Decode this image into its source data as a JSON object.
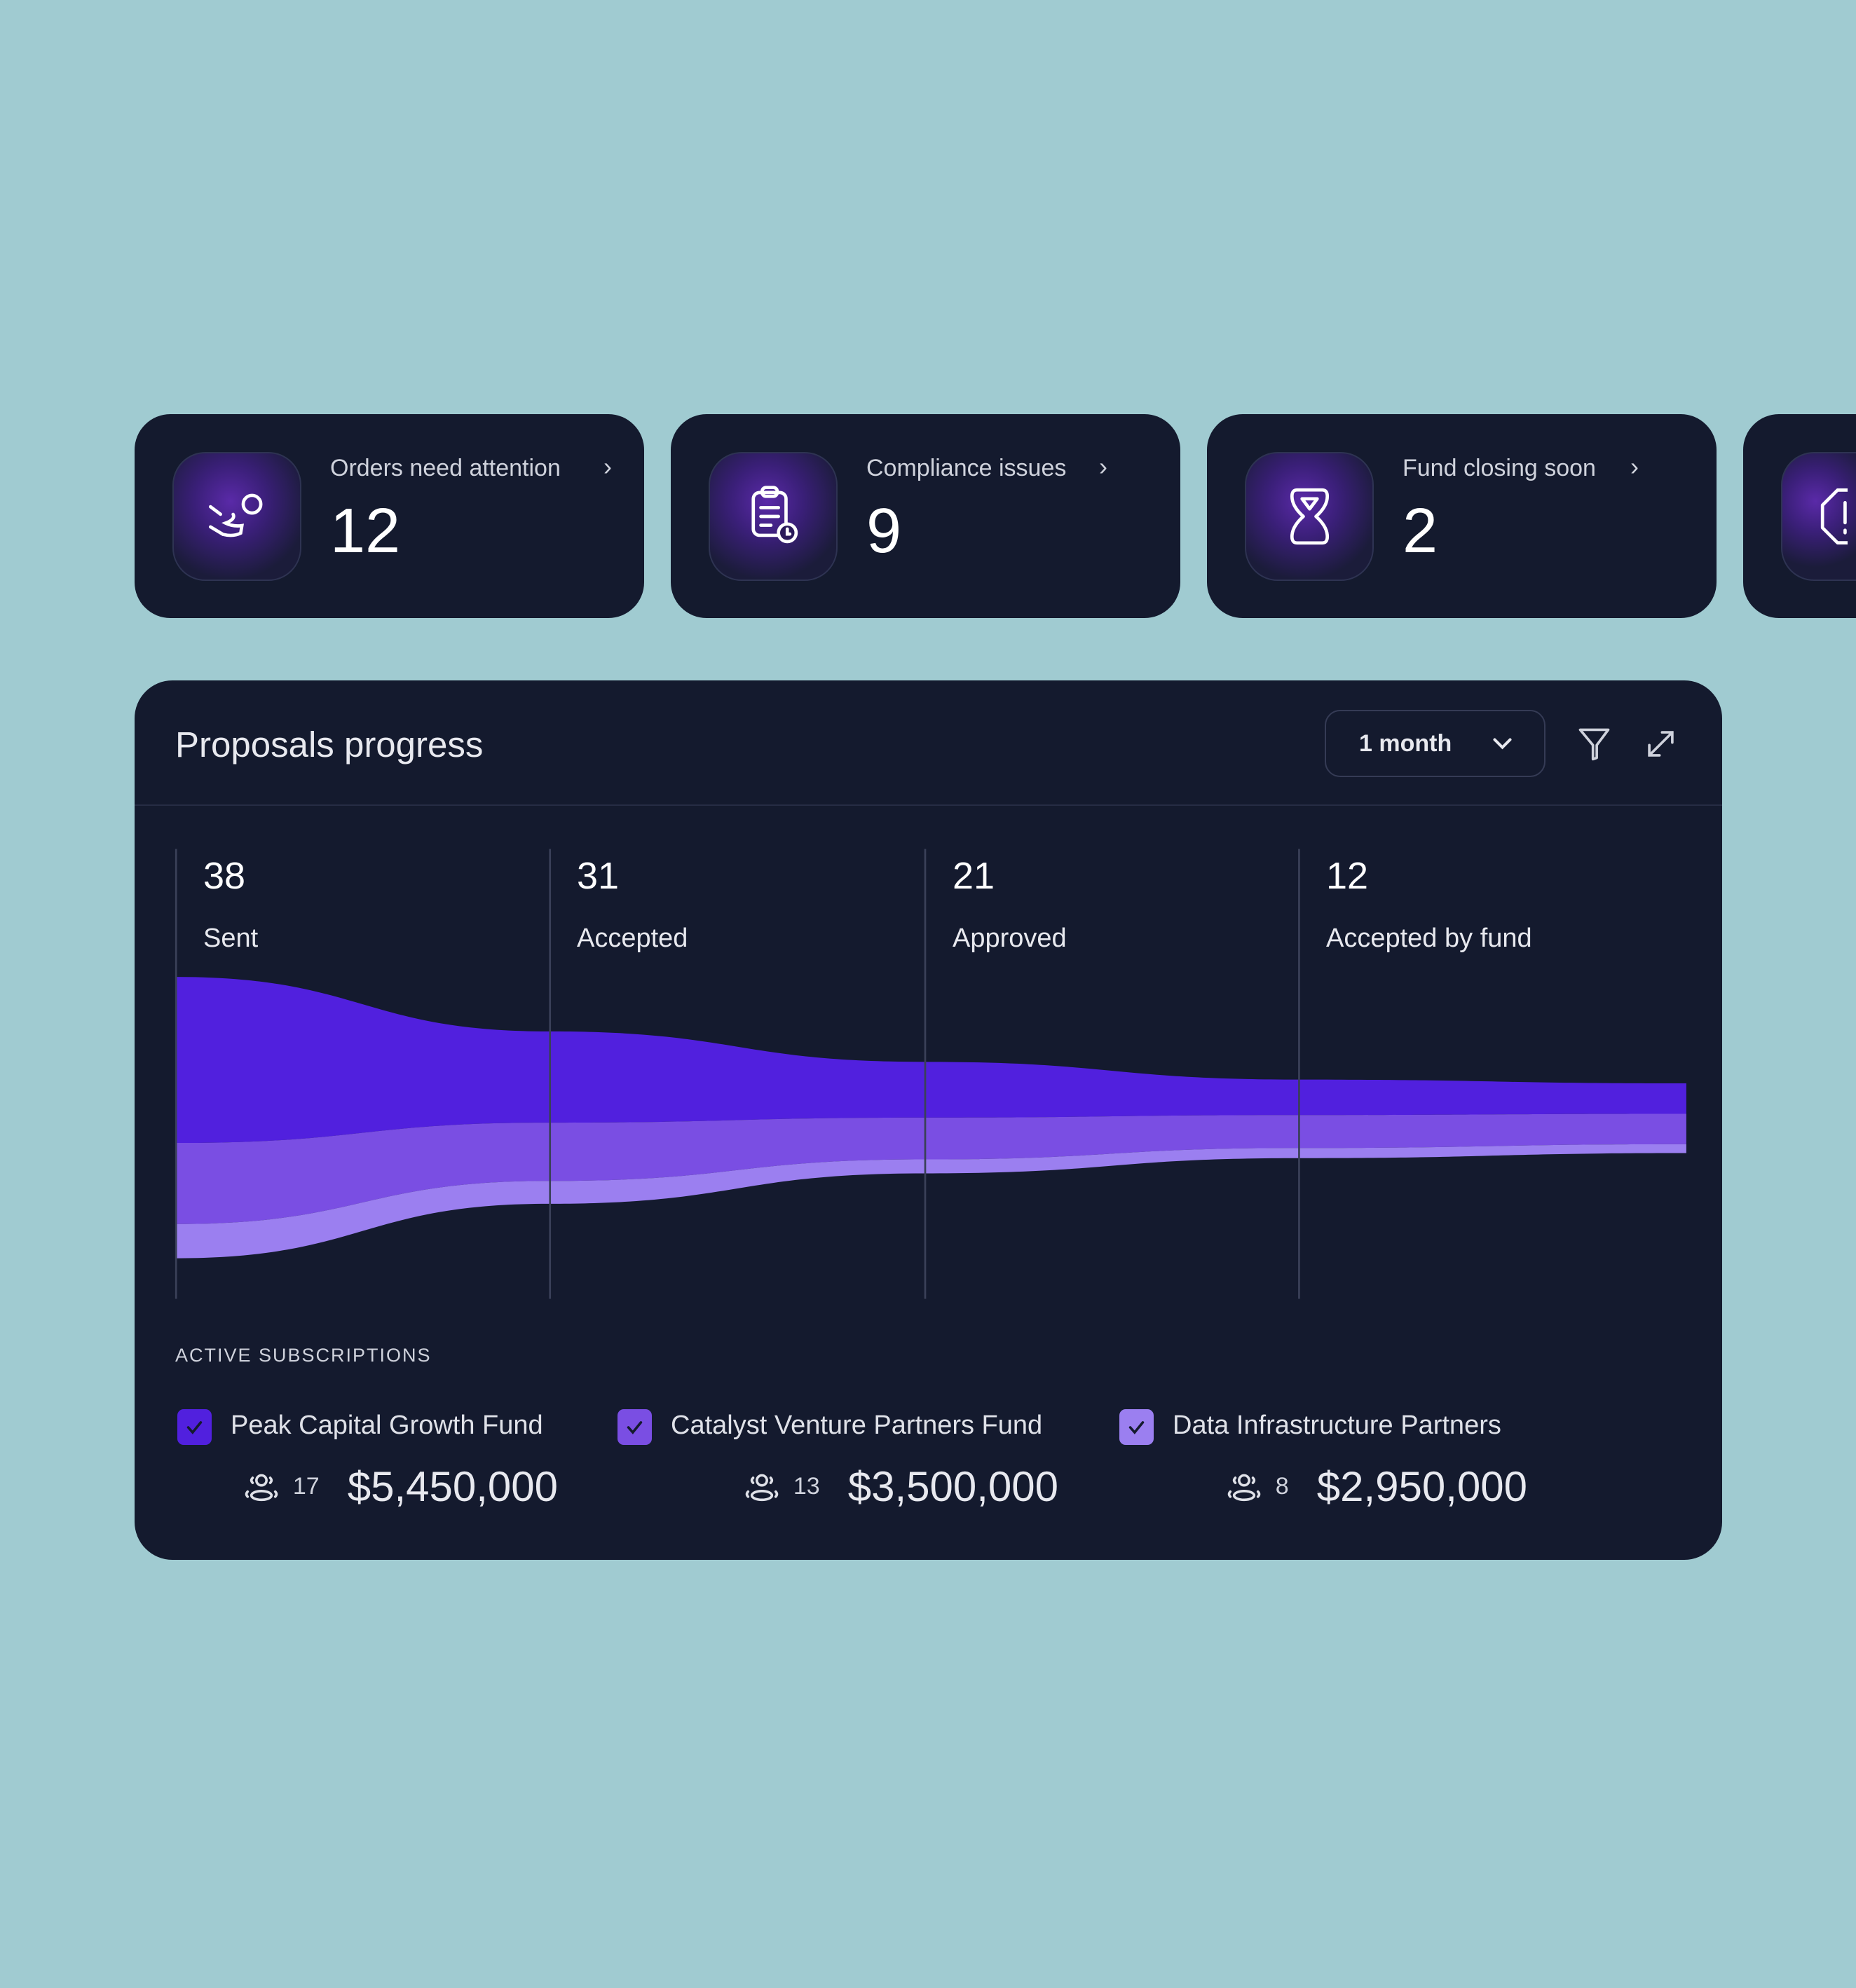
{
  "cards": [
    {
      "label": "Orders need attention",
      "value": "12",
      "icon": "hand-coin-icon"
    },
    {
      "label": "Compliance issues",
      "value": "9",
      "icon": "clipboard-clock-icon"
    },
    {
      "label": "Fund closing soon",
      "value": "2",
      "icon": "hourglass-icon"
    },
    {
      "label": "",
      "value": "",
      "icon": "alert-hexagon-icon"
    }
  ],
  "panel": {
    "title": "Proposals progress",
    "period": "1 month",
    "filter_icon": "filter-icon",
    "expand_icon": "expand-icon",
    "subscriptions_label": "ACTIVE SUBSCRIPTIONS"
  },
  "chart_data": {
    "type": "area",
    "stages": [
      {
        "value": "38",
        "label": "Sent"
      },
      {
        "value": "31",
        "label": "Accepted"
      },
      {
        "value": "21",
        "label": "Approved"
      },
      {
        "value": "12",
        "label": "Accepted by fund"
      }
    ],
    "series": [
      {
        "name": "Peak Capital Growth Fund",
        "color": "#5120de"
      },
      {
        "name": "Catalyst Venture Partners Fund",
        "color": "#7a4ee3"
      },
      {
        "name": "Data Infrastructure Partners",
        "color": "#9b7ff0"
      }
    ]
  },
  "funds": [
    {
      "name": "Peak Capital Growth Fund",
      "count": "17",
      "amount": "$5,450,000",
      "color": "#5120de",
      "checked": true
    },
    {
      "name": "Catalyst Venture Partners Fund",
      "count": "13",
      "amount": "$3,500,000",
      "color": "#7a4ee3",
      "checked": true
    },
    {
      "name": "Data Infrastructure Partners",
      "count": "8",
      "amount": "$2,950,000",
      "color": "#9b7ff0",
      "checked": true
    }
  ]
}
